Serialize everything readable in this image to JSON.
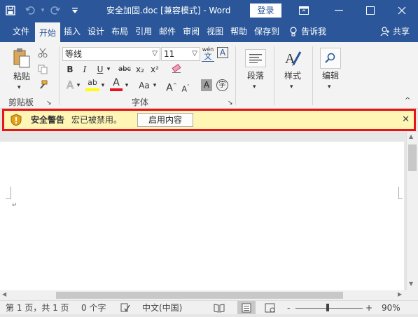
{
  "titlebar": {
    "doc_title": "安全加固.doc [兼容模式]  -  Word",
    "login": "登录",
    "save_icon": "save-icon",
    "undo_icon": "undo-icon",
    "redo_icon": "redo-icon"
  },
  "tabs": [
    {
      "label": "文件"
    },
    {
      "label": "开始"
    },
    {
      "label": "插入"
    },
    {
      "label": "设计"
    },
    {
      "label": "布局"
    },
    {
      "label": "引用"
    },
    {
      "label": "邮件"
    },
    {
      "label": "审阅"
    },
    {
      "label": "视图"
    },
    {
      "label": "帮助"
    },
    {
      "label": "保存到"
    },
    {
      "label": "告诉我"
    },
    {
      "label": "共享"
    }
  ],
  "ribbon": {
    "clipboard": {
      "paste": "粘贴",
      "label": "剪贴板"
    },
    "font": {
      "name": "等线",
      "size": "11",
      "label": "字体",
      "bold": "B",
      "italic": "I",
      "underline": "U",
      "strike": "abc",
      "subscript": "x₂",
      "superscript": "x²",
      "case": "Aa",
      "grow": "A",
      "shrink": "A",
      "wen": "wén",
      "font_color_letter": "A",
      "highlight_letter": "ab",
      "effects_letter": "A",
      "shade_letter": "A",
      "char_border_letter": "A",
      "enclosed_char": "字"
    },
    "paragraph": {
      "label": "段落"
    },
    "styles": {
      "label": "样式"
    },
    "editing": {
      "label": "编辑"
    }
  },
  "security": {
    "title": "安全警告",
    "message": "宏已被禁用。",
    "button": "启用内容"
  },
  "document": {
    "para_mark": "↵"
  },
  "status": {
    "page": "第 1 页，共 1 页",
    "words": "0 个字",
    "lang": "中文(中国)",
    "zoom": "90%",
    "zoom_minus": "-",
    "zoom_plus": "+"
  },
  "colors": {
    "brand": "#2b579a",
    "warning_bg": "#fff5b5",
    "highlight_border": "#e8141a",
    "font_color": "#e81123",
    "highlight_color": "#ffff00"
  }
}
